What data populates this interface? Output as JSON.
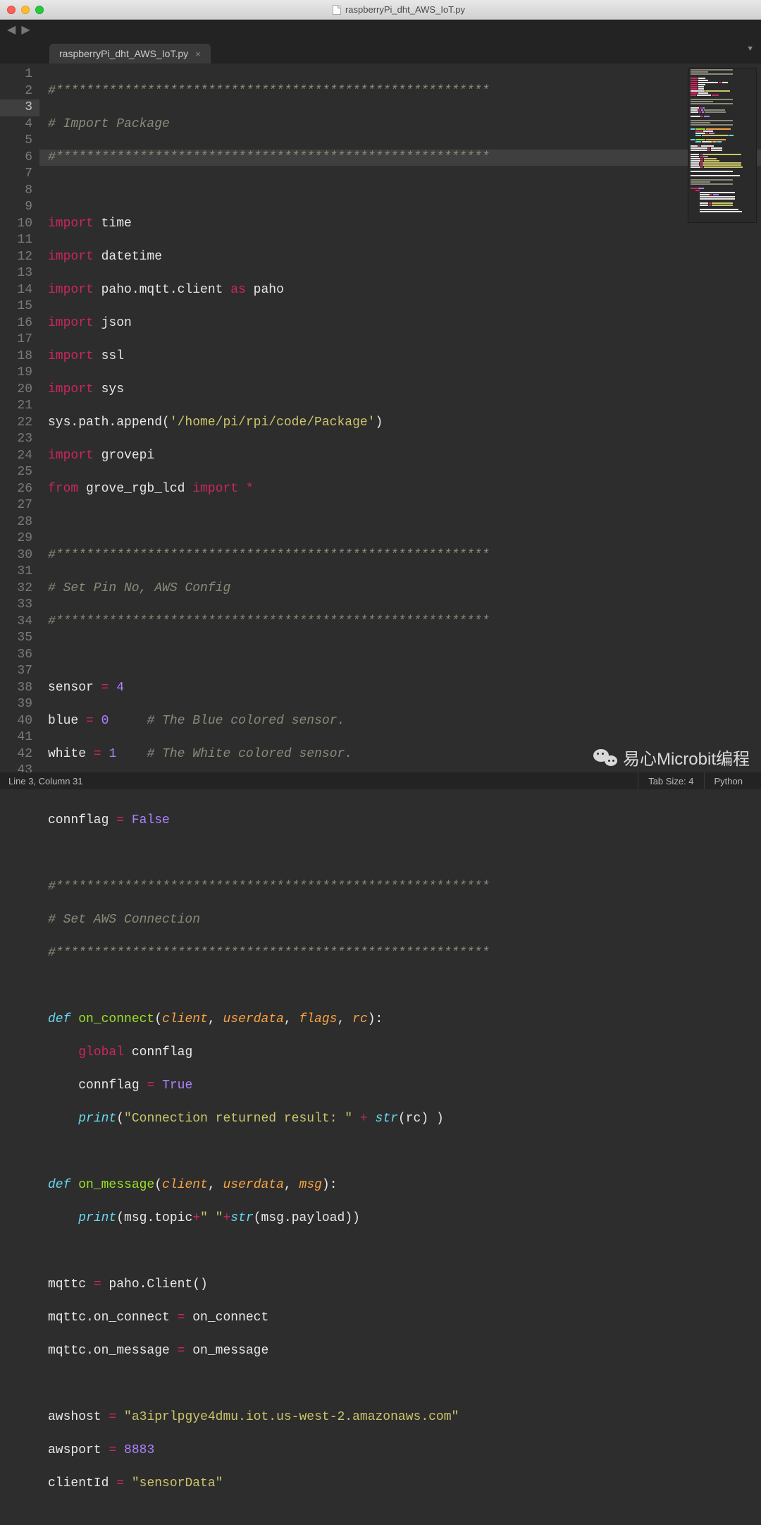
{
  "window": {
    "title": "raspberryPi_dht_AWS_IoT.py"
  },
  "tab": {
    "name": "raspberryPi_dht_AWS_IoT.py",
    "close": "×"
  },
  "status": {
    "position": "Line 3, Column 31",
    "tab_size": "Tab Size: 4",
    "syntax": "Python"
  },
  "code": {
    "l1": "#*********************************************************",
    "l2": "# Import Package",
    "l3": "#*********************************************************",
    "l4": "",
    "l5_kw": "import",
    "l5_t": " time",
    "l6_kw": "import",
    "l6_t": " datetime",
    "l7_kw": "import",
    "l7_t1": " paho.mqtt.client ",
    "l7_as": "as",
    "l7_t2": " paho",
    "l8_kw": "import",
    "l8_t": " json",
    "l9_kw": "import",
    "l9_t": " ssl",
    "l10_kw": "import",
    "l10_t": " sys",
    "l11_a": "sys.path.append(",
    "l11_s": "'/home/pi/rpi/code/Package'",
    "l11_b": ")",
    "l12_kw": "import",
    "l12_t": " grovepi",
    "l13_from": "from",
    "l13_m": " grove_rgb_lcd ",
    "l13_imp": "import",
    "l13_op": " *",
    "l14": "",
    "l15": "#*********************************************************",
    "l16": "# Set Pin No, AWS Config",
    "l17": "#*********************************************************",
    "l18": "",
    "l19_a": "sensor ",
    "l19_eq": "=",
    "l19_b": " ",
    "l19_n": "4",
    "l20_a": "blue ",
    "l20_eq": "=",
    "l20_b": " ",
    "l20_n": "0",
    "l20_pad": "     ",
    "l20_c": "# The Blue colored sensor.",
    "l21_a": "white ",
    "l21_eq": "=",
    "l21_b": " ",
    "l21_n": "1",
    "l21_pad": "    ",
    "l21_c": "# The White colored sensor.",
    "l22": "",
    "l23_a": "connflag ",
    "l23_eq": "=",
    "l23_b": " ",
    "l23_n": "False",
    "l24": "",
    "l25": "#*********************************************************",
    "l26": "# Set AWS Connection",
    "l27": "#*********************************************************",
    "l28": "",
    "l29_def": "def",
    "l29_sp": " ",
    "l29_fn": "on_connect",
    "l29_p1": "(",
    "l29_a1": "client",
    "l29_c1": ", ",
    "l29_a2": "userdata",
    "l29_c2": ", ",
    "l29_a3": "flags",
    "l29_c3": ", ",
    "l29_a4": "rc",
    "l29_p2": "):",
    "l30_ind": "    ",
    "l30_kw": "global",
    "l30_t": " connflag",
    "l31_ind": "    ",
    "l31_a": "connflag ",
    "l31_eq": "=",
    "l31_b": " ",
    "l31_n": "True",
    "l32_ind": "    ",
    "l32_fn": "print",
    "l32_p1": "(",
    "l32_s": "\"Connection returned result: \"",
    "l32_sp": " ",
    "l32_op": "+",
    "l32_sp2": " ",
    "l32_str": "str",
    "l32_p2": "(rc) )",
    "l33": "",
    "l34_def": "def",
    "l34_sp": " ",
    "l34_fn": "on_message",
    "l34_p1": "(",
    "l34_a1": "client",
    "l34_c1": ", ",
    "l34_a2": "userdata",
    "l34_c2": ", ",
    "l34_a3": "msg",
    "l34_p2": "):",
    "l35_ind": "    ",
    "l35_fn": "print",
    "l35_p1": "(msg.topic",
    "l35_op1": "+",
    "l35_s": "\" \"",
    "l35_op2": "+",
    "l35_str": "str",
    "l35_p2": "(msg.payload))",
    "l36": "",
    "l37_a": "mqttc ",
    "l37_eq": "=",
    "l37_b": " paho.Client()",
    "l38_a": "mqttc.on_connect ",
    "l38_eq": "=",
    "l38_b": " on_connect",
    "l39_a": "mqttc.on_message ",
    "l39_eq": "=",
    "l39_b": " on_message",
    "l40": "",
    "l41_a": "awshost ",
    "l41_eq": "=",
    "l41_b": " ",
    "l41_s": "\"a3iprlpgye4dmu.iot.us-west-2.amazonaws.com\"",
    "l42_a": "awsport ",
    "l42_eq": "=",
    "l42_b": " ",
    "l42_n": "8883",
    "l43_a": "clientId ",
    "l43_eq": "=",
    "l43_b": " ",
    "l43_s": "\"sensorData\""
  },
  "watermark": {
    "text": "易心Microbit编程"
  }
}
